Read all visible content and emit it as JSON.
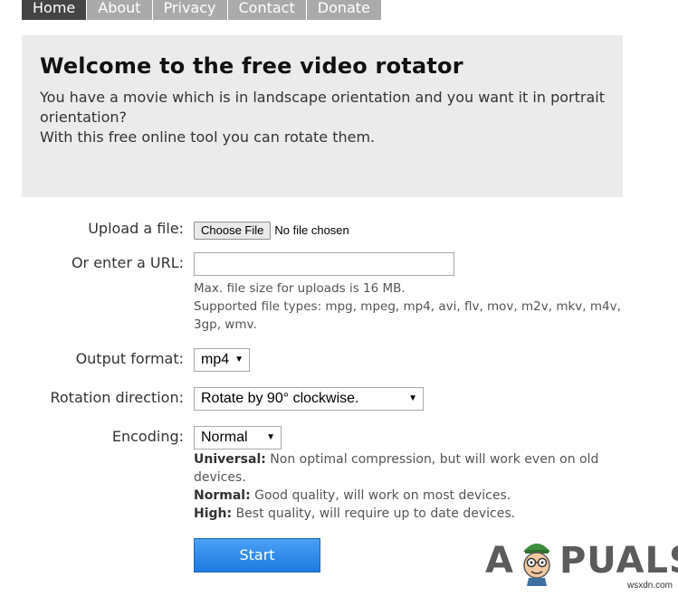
{
  "nav": {
    "items": [
      "Home",
      "About",
      "Privacy",
      "Contact",
      "Donate"
    ],
    "active_index": 0
  },
  "welcome": {
    "title": "Welcome to the free video rotator",
    "line1": "You have a movie which is in landscape orientation and you want it in portrait orientation?",
    "line2": "With this free online tool you can rotate them."
  },
  "form": {
    "upload_label": "Upload a file:",
    "choose_file_button": "Choose File",
    "file_status": "No file chosen",
    "url_label": "Or enter a URL:",
    "url_value": "",
    "hint_size": "Max. file size for uploads is 16 MB.",
    "hint_types": "Supported file types: mpg, mpeg, mp4, avi, flv, mov, m2v, mkv, m4v, 3gp, wmv.",
    "output_label": "Output format:",
    "output_value": "mp4",
    "rotation_label": "Rotation direction:",
    "rotation_value": "Rotate by 90° clockwise.",
    "encoding_label": "Encoding:",
    "encoding_value": "Normal",
    "enc_universal_term": "Universal:",
    "enc_universal_desc": "Non optimal compression, but will work even on old devices.",
    "enc_normal_term": "Normal:",
    "enc_normal_desc": "Good quality, will work on most devices.",
    "enc_high_term": "High:",
    "enc_high_desc": "Best quality, will require up to date devices.",
    "start_button": "Start"
  },
  "watermark": {
    "logo_text_left": "A",
    "logo_text_right": "PUALS",
    "site": "wsxdn.com"
  },
  "colors": {
    "nav_bg": "#aaaaaa",
    "nav_active_bg": "#444444",
    "welcome_bg": "#ebebeb",
    "start_button_bg": "#2f88e8"
  }
}
